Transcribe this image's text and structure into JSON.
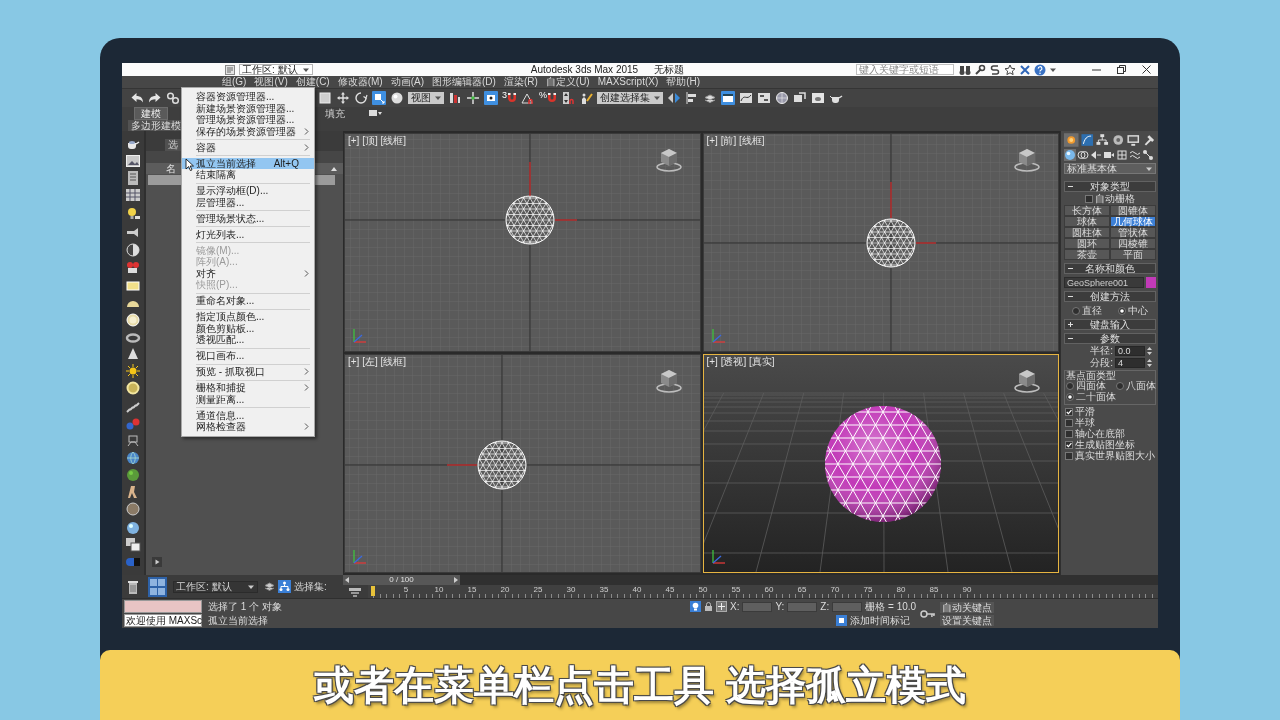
{
  "title_bar": {
    "workspace": "工作区: 默认",
    "app": "Autodesk 3ds Max 2015",
    "document": "无标题",
    "search_placeholder": "键入关键字或短语"
  },
  "menu_bar": [
    "组(G)",
    "视图(V)",
    "创建(C)",
    "修改器(M)",
    "动画(A)",
    "图形编辑器(D)",
    "渲染(R)",
    "自定义(U)",
    "MAXScript(X)",
    "帮助(H)"
  ],
  "tools_menu": {
    "groups": [
      [
        {
          "label": "容器资源管理器...",
          "disabled": false,
          "selected": false,
          "submenu": false
        },
        {
          "label": "新建场景资源管理器...",
          "disabled": false,
          "selected": false,
          "submenu": false
        },
        {
          "label": "管理场景资源管理器...",
          "disabled": false,
          "selected": false,
          "submenu": false
        },
        {
          "label": "保存的场景资源管理器",
          "disabled": false,
          "selected": false,
          "submenu": true
        }
      ],
      [
        {
          "label": "容器",
          "disabled": false,
          "selected": false,
          "submenu": true
        }
      ],
      [
        {
          "label": "孤立当前选择",
          "shortcut": "Alt+Q",
          "disabled": false,
          "selected": true,
          "submenu": false
        },
        {
          "label": "结束隔离",
          "disabled": false,
          "selected": false,
          "submenu": false
        }
      ],
      [
        {
          "label": "显示浮动框(D)...",
          "disabled": false,
          "selected": false,
          "submenu": false
        },
        {
          "label": "层管理器...",
          "disabled": false,
          "selected": false,
          "submenu": false
        }
      ],
      [
        {
          "label": "管理场景状态...",
          "disabled": false,
          "selected": false,
          "submenu": false
        }
      ],
      [
        {
          "label": "灯光列表...",
          "disabled": false,
          "selected": false,
          "submenu": false
        }
      ],
      [
        {
          "label": "镜像(M)...",
          "disabled": true,
          "selected": false,
          "submenu": false
        },
        {
          "label": "阵列(A)...",
          "disabled": true,
          "selected": false,
          "submenu": false
        },
        {
          "label": "对齐",
          "disabled": false,
          "selected": false,
          "submenu": true
        },
        {
          "label": "快照(P)...",
          "disabled": true,
          "selected": false,
          "submenu": false
        }
      ],
      [
        {
          "label": "重命名对象...",
          "disabled": false,
          "selected": false,
          "submenu": false
        }
      ],
      [
        {
          "label": "指定顶点颜色...",
          "disabled": false,
          "selected": false,
          "submenu": false
        },
        {
          "label": "颜色剪贴板...",
          "disabled": false,
          "selected": false,
          "submenu": false
        },
        {
          "label": "透视匹配...",
          "disabled": false,
          "selected": false,
          "submenu": false
        }
      ],
      [
        {
          "label": "视口画布...",
          "disabled": false,
          "selected": false,
          "submenu": false
        }
      ],
      [
        {
          "label": "预览 - 抓取视口",
          "disabled": false,
          "selected": false,
          "submenu": true
        }
      ],
      [
        {
          "label": "栅格和捕捉",
          "disabled": false,
          "selected": false,
          "submenu": true
        },
        {
          "label": "测量距离...",
          "disabled": false,
          "selected": false,
          "submenu": false
        }
      ],
      [
        {
          "label": "通道信息...",
          "disabled": false,
          "selected": false,
          "submenu": false
        },
        {
          "label": "网格检查器",
          "disabled": false,
          "selected": false,
          "submenu": true
        }
      ]
    ]
  },
  "toolbar": [
    {
      "items": [
        {
          "kind": "undo",
          "on": false
        },
        {
          "kind": "redo",
          "on": false
        },
        {
          "kind": "link",
          "on": false
        }
      ]
    },
    {
      "items": [
        {
          "kind": "select",
          "on": false
        },
        {
          "kind": "move",
          "on": false
        },
        {
          "kind": "rotate",
          "on": false
        },
        {
          "kind": "scale",
          "on": true
        },
        {
          "kind": "place",
          "on": false
        },
        {
          "kind": "dropdown",
          "value": "视图"
        },
        {
          "kind": "pivot",
          "on": false
        },
        {
          "kind": "manipulate",
          "on": false
        },
        {
          "kind": "shortcut",
          "on": true
        },
        {
          "kind": "snap",
          "label": "3",
          "on": false
        },
        {
          "kind": "angle",
          "on": false
        },
        {
          "kind": "percent",
          "label": "%",
          "on": false
        },
        {
          "kind": "spinner",
          "on": false
        },
        {
          "kind": "named",
          "on": false
        },
        {
          "kind": "dropdown",
          "value": "创建选择集"
        },
        {
          "kind": "mirror",
          "on": false
        },
        {
          "kind": "align",
          "on": false
        },
        {
          "kind": "layers",
          "on": false
        },
        {
          "kind": "ribbon",
          "on": true
        },
        {
          "kind": "curve",
          "on": false
        },
        {
          "kind": "schematic",
          "on": false
        },
        {
          "kind": "material",
          "on": false
        },
        {
          "kind": "render",
          "on": false
        },
        {
          "kind": "frame",
          "on": false
        },
        {
          "kind": "teapot",
          "on": false
        }
      ]
    }
  ],
  "ribbon": {
    "tabs": [
      {
        "label": "建模",
        "selected": true
      },
      {
        "label": "填充",
        "selected": false
      }
    ],
    "panel": "多边形建模"
  },
  "explorer": {
    "tab": "选",
    "column": "名",
    "rows": [
      {
        "selected": true
      }
    ]
  },
  "viewports": [
    {
      "label": "[+] [顶] [线框]",
      "kind": "wireframe",
      "active": false
    },
    {
      "label": "[+] [前] [线框]",
      "kind": "wireframe",
      "active": false
    },
    {
      "label": "[+] [左] [线框]",
      "kind": "wireframe",
      "active": false
    },
    {
      "label": "[+] [透视] [真实]",
      "kind": "shaded",
      "active": true
    }
  ],
  "command_panel": {
    "tabs": [
      {
        "kind": "create",
        "selected": true
      },
      {
        "kind": "modify",
        "selected": false
      },
      {
        "kind": "hierarchy",
        "selected": false
      },
      {
        "kind": "motion",
        "selected": false
      },
      {
        "kind": "display",
        "selected": false
      },
      {
        "kind": "utilities",
        "selected": false
      }
    ],
    "categories": [
      {
        "kind": "geometry",
        "selected": true
      },
      {
        "kind": "shapes",
        "selected": false
      },
      {
        "kind": "lights",
        "selected": false
      },
      {
        "kind": "cameras",
        "selected": false
      },
      {
        "kind": "helpers",
        "selected": false
      },
      {
        "kind": "spacewarps",
        "selected": false
      },
      {
        "kind": "systems",
        "selected": false
      }
    ],
    "type_dropdown": "标准基本体",
    "rollouts": [
      {
        "kind": "object_type",
        "title": "对象类型",
        "expanded": true,
        "autogrid": {
          "label": "自动栅格",
          "checked": false
        },
        "buttons": [
          {
            "label": "长方体",
            "selected": false
          },
          {
            "label": "圆锥体",
            "selected": false
          },
          {
            "label": "球体",
            "selected": false
          },
          {
            "label": "几何球体",
            "selected": true
          },
          {
            "label": "圆柱体",
            "selected": false
          },
          {
            "label": "管状体",
            "selected": false
          },
          {
            "label": "圆环",
            "selected": false
          },
          {
            "label": "四棱锥",
            "selected": false
          },
          {
            "label": "茶壶",
            "selected": false
          },
          {
            "label": "平面",
            "selected": false
          }
        ]
      },
      {
        "kind": "name_color",
        "title": "名称和颜色",
        "expanded": true,
        "name": "GeoSphere001",
        "color": "#c23ab8"
      },
      {
        "kind": "creation_method",
        "title": "创建方法",
        "expanded": true,
        "options": [
          {
            "label": "直径",
            "selected": false
          },
          {
            "label": "中心",
            "selected": true
          }
        ]
      },
      {
        "kind": "keyboard_entry",
        "title": "键盘输入",
        "expanded": false
      },
      {
        "kind": "parameters",
        "title": "参数",
        "expanded": true,
        "spinners": [
          {
            "label": "半径:",
            "value": "0.0"
          },
          {
            "label": "分段:",
            "value": "4"
          }
        ],
        "base_type": {
          "title": "基点面类型",
          "options": [
            {
              "label": "四面体",
              "selected": false
            },
            {
              "label": "八面体",
              "selected": false
            },
            {
              "label": "二十面体",
              "selected": true
            }
          ]
        },
        "checks": [
          {
            "label": "平滑",
            "checked": true
          },
          {
            "label": "半球",
            "checked": false
          },
          {
            "label": "轴心在底部",
            "checked": false
          },
          {
            "label": "生成贴图坐标",
            "checked": true
          },
          {
            "label": "真实世界贴图大小",
            "checked": false
          }
        ]
      }
    ]
  },
  "workspace": "工作区: 默认",
  "selection_set": "选择集:",
  "time_slider": {
    "label": "0 / 100",
    "level": 0
  },
  "track_bar": {
    "ticks": [
      "5",
      "10",
      "15",
      "20",
      "25",
      "30",
      "35",
      "40",
      "45",
      "50",
      "55",
      "60",
      "65",
      "70",
      "75",
      "80",
      "85",
      "90"
    ]
  },
  "status_bar": {
    "listener": "欢迎使用 MAXSc",
    "prompt": "选择了 1 个 对象",
    "hint": "孤立当前选择",
    "isolate": true,
    "coordinates": [
      {
        "label": "X:"
      },
      {
        "label": "Y:"
      },
      {
        "label": "Z:"
      }
    ],
    "grid": "栅格 = 10.0",
    "time_tag": "添加时间标记",
    "auto_key": "自动关键点",
    "set_key": "设置关键点"
  },
  "subtitle": "或者在菜单栏点击工具 选择孤立模式"
}
